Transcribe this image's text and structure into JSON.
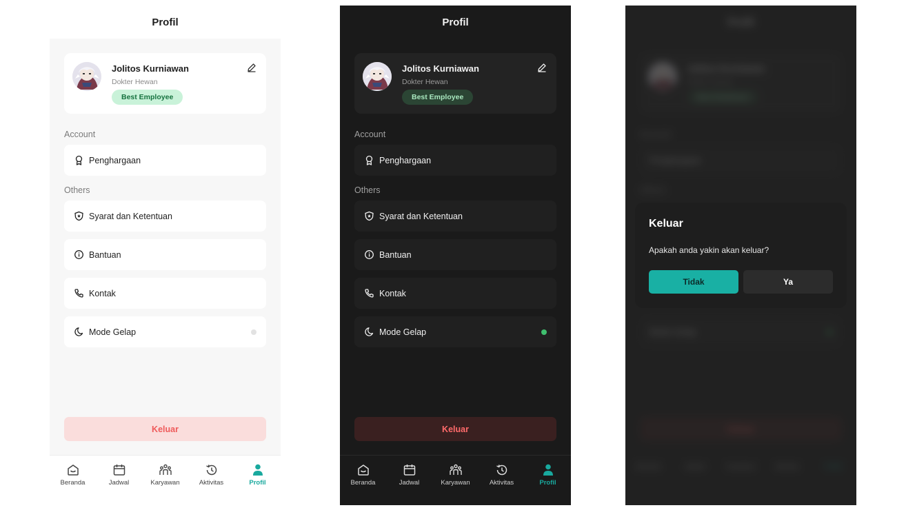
{
  "header": {
    "title": "Profil"
  },
  "profile": {
    "name": "Jolitos Kurniawan",
    "role": "Dokter Hewan",
    "badge": "Best Employee"
  },
  "sections": {
    "account_label": "Account",
    "others_label": "Others"
  },
  "menu": {
    "penghargaan": {
      "label": "Penghargaan",
      "icon": "award-icon"
    },
    "syarat": {
      "label": "Syarat dan Ketentuan",
      "icon": "shield-star-icon"
    },
    "bantuan": {
      "label": "Bantuan",
      "icon": "info-icon"
    },
    "kontak": {
      "label": "Kontak",
      "icon": "phone-icon"
    },
    "mode_gelap": {
      "label": "Mode Gelap",
      "icon": "moon-icon"
    }
  },
  "logout_label": "Keluar",
  "nav": {
    "beranda": "Beranda",
    "jadwal": "Jadwal",
    "karyawan": "Karyawan",
    "aktivitas": "Aktivitas",
    "profil": "Profil"
  },
  "modal": {
    "title": "Keluar",
    "message": "Apakah anda yakin akan keluar?",
    "cancel_label": "Tidak",
    "confirm_label": "Ya"
  },
  "colors": {
    "accent": "#19a99e",
    "danger": "#ef5b5b",
    "badge_light_bg": "#c9f2d9",
    "toggle_on": "#3fbf6e"
  },
  "states": {
    "light_dark_mode_toggle": "off",
    "dark_dark_mode_toggle": "on"
  }
}
